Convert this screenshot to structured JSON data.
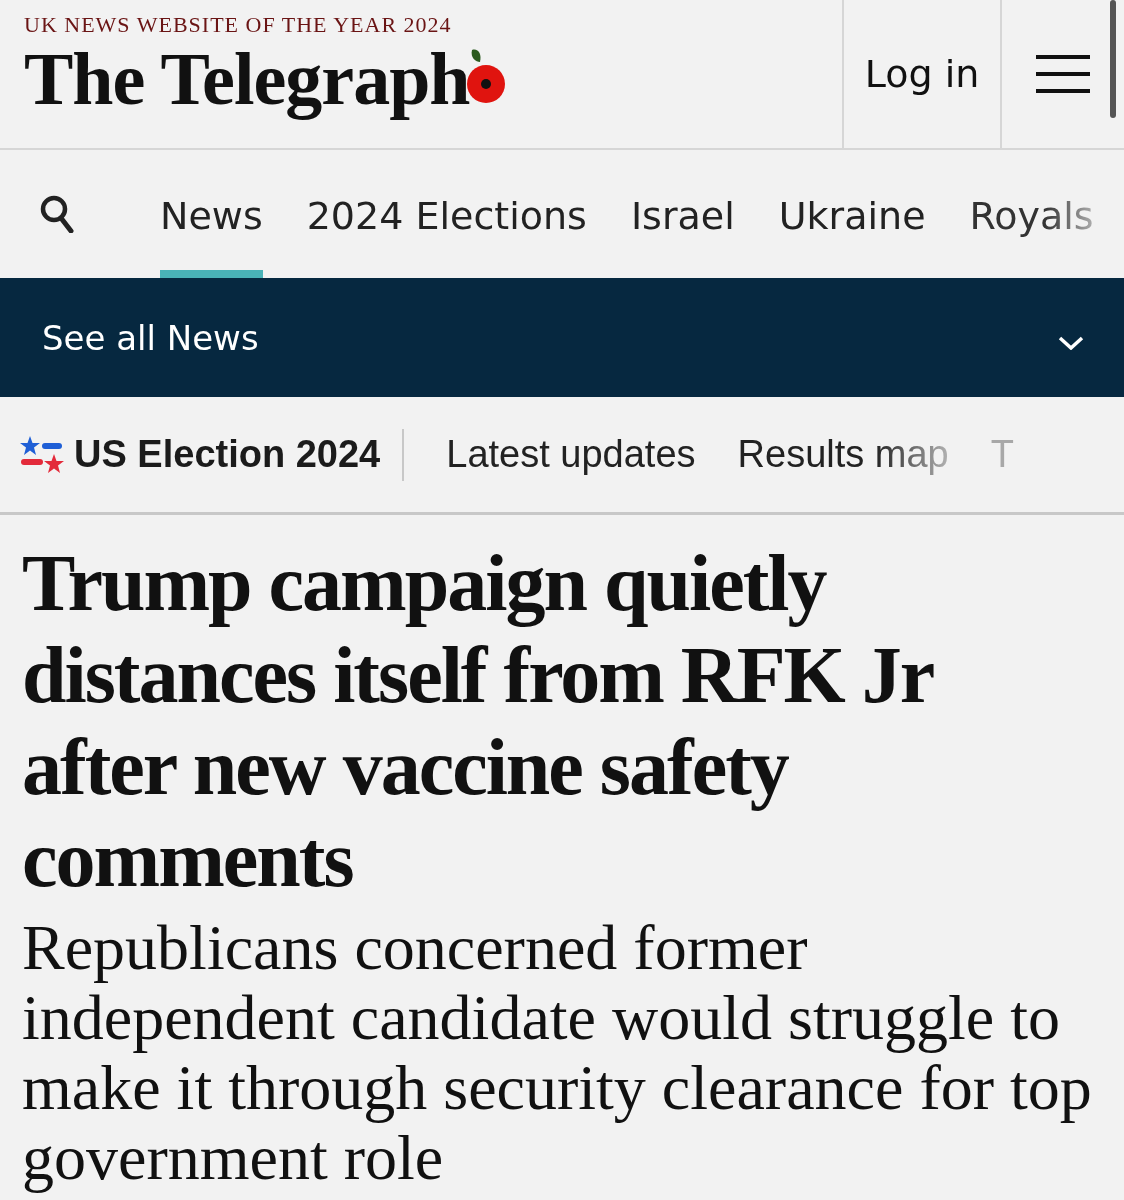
{
  "masthead": {
    "tagline": "UK NEWS WEBSITE OF THE YEAR 2024",
    "logo": "The Telegraph",
    "login": "Log in"
  },
  "nav": {
    "tabs": [
      {
        "label": "News",
        "selected": true
      },
      {
        "label": "2024 Elections",
        "selected": false
      },
      {
        "label": "Israel",
        "selected": false
      },
      {
        "label": "Ukraine",
        "selected": false
      },
      {
        "label": "Royals",
        "selected": false
      }
    ]
  },
  "section_bar": {
    "label": "See all News"
  },
  "election_bar": {
    "title": "US Election 2024",
    "links": [
      "Latest updates",
      "Results map",
      "T"
    ]
  },
  "article": {
    "headline": "Trump campaign quietly distances itself from RFK Jr after new vaccine safety comments",
    "standfirst": "Republicans concerned former independent candidate would struggle to make it through security clearance for top government role"
  }
}
